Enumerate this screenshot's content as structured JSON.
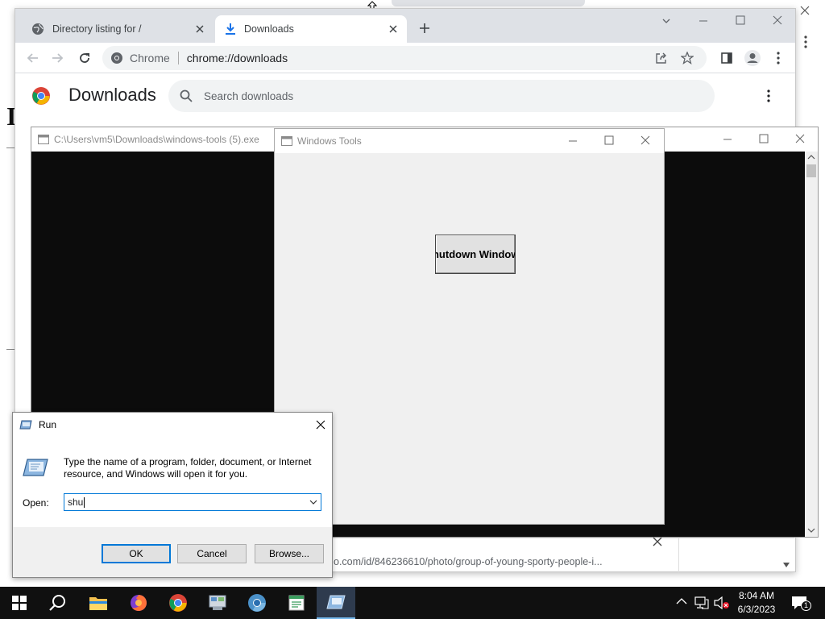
{
  "chrome": {
    "tabs": [
      {
        "title": "Directory listing for /"
      },
      {
        "title": "Downloads"
      }
    ],
    "omnibox_chip": "Chrome",
    "omnibox_url": "chrome://downloads"
  },
  "background_page": {
    "heading_initial": "I"
  },
  "downloads_page": {
    "title": "Downloads",
    "search_placeholder": "Search downloads"
  },
  "console_window": {
    "title": "C:\\Users\\vm5\\Downloads\\windows-tools (5).exe"
  },
  "windows_tools": {
    "title": "Windows Tools",
    "shutdown_button": "Shutdown Windows"
  },
  "downloads_bar": {
    "url_fragment": "o.com/id/846236610/photo/group-of-young-sporty-people-i..."
  },
  "run_dialog": {
    "title": "Run",
    "description": "Type the name of a program, folder, document, or Internet resource, and Windows will open it for you.",
    "open_label": "Open:",
    "open_value": "shu",
    "ok_label": "OK",
    "cancel_label": "Cancel",
    "browse_label": "Browse..."
  },
  "taskbar": {
    "time": "8:04 AM",
    "date": "6/3/2023",
    "notification_count": "1"
  }
}
